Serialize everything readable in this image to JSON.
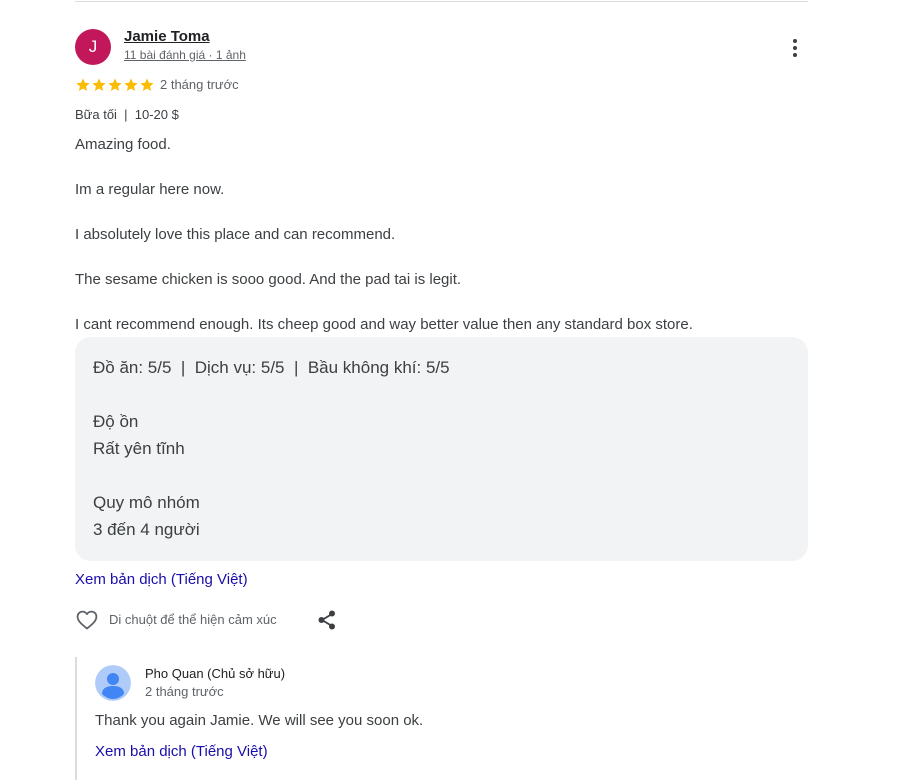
{
  "review": {
    "avatar_initial": "J",
    "avatar_color": "#c2185b",
    "author_name": "Jamie Toma",
    "author_meta": "11 bài đánh giá · 1 ảnh",
    "rating": 5,
    "star_color": "#fbbc04",
    "time": "2 tháng trước",
    "meal_line": "Bữa tối  |  10-20 $",
    "paragraphs": [
      "Amazing food.",
      "Im a regular here now.",
      "I absolutely love this place and can recommend.",
      "The sesame chicken is sooo good. And the pad tai is legit.",
      "I cant recommend enough. Its cheep good and way better value then any standard box store."
    ],
    "ratings_line": "Đồ ăn: 5/5  |  Dịch vụ: 5/5  |  Bầu không khí: 5/5",
    "noise_label": "Độ ồn",
    "noise_value": "Rất yên tĩnh",
    "group_label": "Quy mô nhóm",
    "group_value": "3 đến 4 người",
    "translate_link": "Xem bản dịch (Tiếng Việt)",
    "reaction_text": "Di chuột để thể hiện cảm xúc"
  },
  "owner_reply": {
    "name": "Pho Quan (Chủ sở hữu)",
    "time": "2 tháng trước",
    "text": "Thank you again Jamie. We will see you soon ok.",
    "translate_link": "Xem bản dịch (Tiếng Việt)"
  },
  "icons": {
    "more": "more-vert-icon",
    "heart": "heart-outline-icon",
    "share": "share-icon",
    "star": "star-icon",
    "owner_avatar": "default-user-avatar-icon"
  },
  "colors": {
    "link": "#1a0dab",
    "ratings_box_bg": "#f1f3f4",
    "owner_avatar_bg": "#aecbfa",
    "owner_avatar_fg": "#4285f4"
  }
}
